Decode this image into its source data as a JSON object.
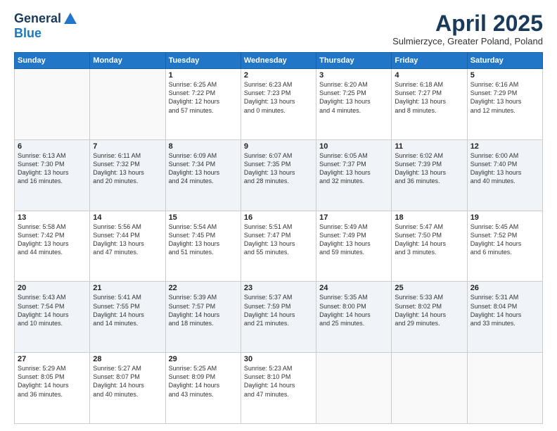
{
  "header": {
    "logo_general": "General",
    "logo_blue": "Blue",
    "month_title": "April 2025",
    "location": "Sulmierzyce, Greater Poland, Poland"
  },
  "days_of_week": [
    "Sunday",
    "Monday",
    "Tuesday",
    "Wednesday",
    "Thursday",
    "Friday",
    "Saturday"
  ],
  "weeks": [
    [
      {
        "num": "",
        "info": ""
      },
      {
        "num": "",
        "info": ""
      },
      {
        "num": "1",
        "info": "Sunrise: 6:25 AM\nSunset: 7:22 PM\nDaylight: 12 hours\nand 57 minutes."
      },
      {
        "num": "2",
        "info": "Sunrise: 6:23 AM\nSunset: 7:23 PM\nDaylight: 13 hours\nand 0 minutes."
      },
      {
        "num": "3",
        "info": "Sunrise: 6:20 AM\nSunset: 7:25 PM\nDaylight: 13 hours\nand 4 minutes."
      },
      {
        "num": "4",
        "info": "Sunrise: 6:18 AM\nSunset: 7:27 PM\nDaylight: 13 hours\nand 8 minutes."
      },
      {
        "num": "5",
        "info": "Sunrise: 6:16 AM\nSunset: 7:29 PM\nDaylight: 13 hours\nand 12 minutes."
      }
    ],
    [
      {
        "num": "6",
        "info": "Sunrise: 6:13 AM\nSunset: 7:30 PM\nDaylight: 13 hours\nand 16 minutes."
      },
      {
        "num": "7",
        "info": "Sunrise: 6:11 AM\nSunset: 7:32 PM\nDaylight: 13 hours\nand 20 minutes."
      },
      {
        "num": "8",
        "info": "Sunrise: 6:09 AM\nSunset: 7:34 PM\nDaylight: 13 hours\nand 24 minutes."
      },
      {
        "num": "9",
        "info": "Sunrise: 6:07 AM\nSunset: 7:35 PM\nDaylight: 13 hours\nand 28 minutes."
      },
      {
        "num": "10",
        "info": "Sunrise: 6:05 AM\nSunset: 7:37 PM\nDaylight: 13 hours\nand 32 minutes."
      },
      {
        "num": "11",
        "info": "Sunrise: 6:02 AM\nSunset: 7:39 PM\nDaylight: 13 hours\nand 36 minutes."
      },
      {
        "num": "12",
        "info": "Sunrise: 6:00 AM\nSunset: 7:40 PM\nDaylight: 13 hours\nand 40 minutes."
      }
    ],
    [
      {
        "num": "13",
        "info": "Sunrise: 5:58 AM\nSunset: 7:42 PM\nDaylight: 13 hours\nand 44 minutes."
      },
      {
        "num": "14",
        "info": "Sunrise: 5:56 AM\nSunset: 7:44 PM\nDaylight: 13 hours\nand 47 minutes."
      },
      {
        "num": "15",
        "info": "Sunrise: 5:54 AM\nSunset: 7:45 PM\nDaylight: 13 hours\nand 51 minutes."
      },
      {
        "num": "16",
        "info": "Sunrise: 5:51 AM\nSunset: 7:47 PM\nDaylight: 13 hours\nand 55 minutes."
      },
      {
        "num": "17",
        "info": "Sunrise: 5:49 AM\nSunset: 7:49 PM\nDaylight: 13 hours\nand 59 minutes."
      },
      {
        "num": "18",
        "info": "Sunrise: 5:47 AM\nSunset: 7:50 PM\nDaylight: 14 hours\nand 3 minutes."
      },
      {
        "num": "19",
        "info": "Sunrise: 5:45 AM\nSunset: 7:52 PM\nDaylight: 14 hours\nand 6 minutes."
      }
    ],
    [
      {
        "num": "20",
        "info": "Sunrise: 5:43 AM\nSunset: 7:54 PM\nDaylight: 14 hours\nand 10 minutes."
      },
      {
        "num": "21",
        "info": "Sunrise: 5:41 AM\nSunset: 7:55 PM\nDaylight: 14 hours\nand 14 minutes."
      },
      {
        "num": "22",
        "info": "Sunrise: 5:39 AM\nSunset: 7:57 PM\nDaylight: 14 hours\nand 18 minutes."
      },
      {
        "num": "23",
        "info": "Sunrise: 5:37 AM\nSunset: 7:59 PM\nDaylight: 14 hours\nand 21 minutes."
      },
      {
        "num": "24",
        "info": "Sunrise: 5:35 AM\nSunset: 8:00 PM\nDaylight: 14 hours\nand 25 minutes."
      },
      {
        "num": "25",
        "info": "Sunrise: 5:33 AM\nSunset: 8:02 PM\nDaylight: 14 hours\nand 29 minutes."
      },
      {
        "num": "26",
        "info": "Sunrise: 5:31 AM\nSunset: 8:04 PM\nDaylight: 14 hours\nand 33 minutes."
      }
    ],
    [
      {
        "num": "27",
        "info": "Sunrise: 5:29 AM\nSunset: 8:05 PM\nDaylight: 14 hours\nand 36 minutes."
      },
      {
        "num": "28",
        "info": "Sunrise: 5:27 AM\nSunset: 8:07 PM\nDaylight: 14 hours\nand 40 minutes."
      },
      {
        "num": "29",
        "info": "Sunrise: 5:25 AM\nSunset: 8:09 PM\nDaylight: 14 hours\nand 43 minutes."
      },
      {
        "num": "30",
        "info": "Sunrise: 5:23 AM\nSunset: 8:10 PM\nDaylight: 14 hours\nand 47 minutes."
      },
      {
        "num": "",
        "info": ""
      },
      {
        "num": "",
        "info": ""
      },
      {
        "num": "",
        "info": ""
      }
    ]
  ]
}
